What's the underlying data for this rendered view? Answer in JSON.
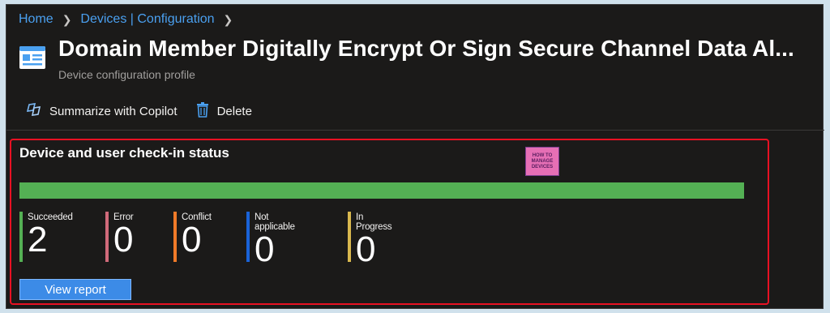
{
  "breadcrumb": [
    {
      "label": "Home"
    },
    {
      "label": "Devices | Configuration"
    }
  ],
  "header": {
    "title": "Domain Member Digitally Encrypt Or Sign Secure Channel Data Al...",
    "subtitle": "Device configuration profile",
    "icon": "profile-icon"
  },
  "toolbar": {
    "copilot_label": "Summarize with Copilot",
    "delete_label": "Delete"
  },
  "card": {
    "title": "Device and user check-in status",
    "progress_succeeded_fraction": 1.0,
    "watermark": [
      "HOW TO",
      "MANAGE",
      "DEVICES"
    ],
    "stats": [
      {
        "label": "Succeeded",
        "value": "2",
        "color": "#54b054"
      },
      {
        "label": "Error",
        "value": "0",
        "color": "#d06a7a"
      },
      {
        "label": "Conflict",
        "value": "0",
        "color": "#f07a28"
      },
      {
        "label": "Not applicable",
        "value": "0",
        "color": "#1a63d8"
      },
      {
        "label": "In Progress",
        "value": "0",
        "color": "#d9b84e"
      }
    ],
    "view_report_label": "View report"
  },
  "colors": {
    "accent": "#3c8be7",
    "link": "#4aa0f0",
    "background": "#1b1a19",
    "highlight_border": "#e81123"
  }
}
